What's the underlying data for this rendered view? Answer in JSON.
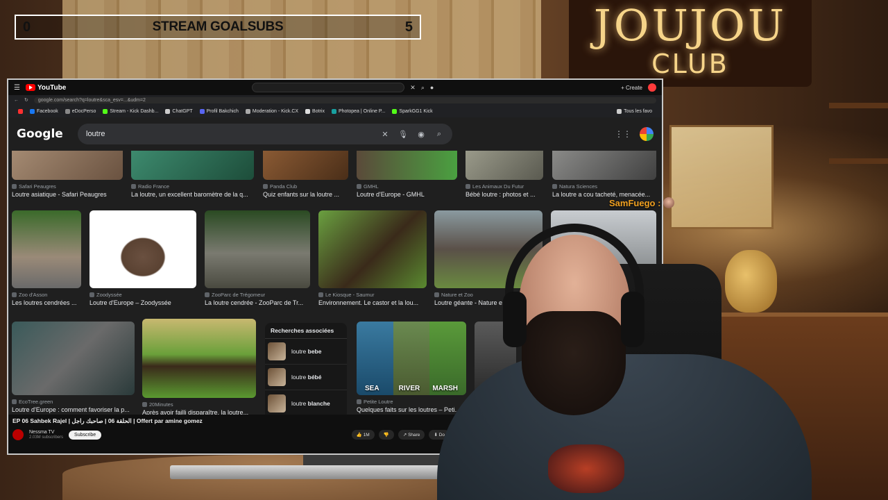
{
  "stream_goal": {
    "current": "0",
    "label": "STREAM GOALSUBS",
    "target": "5"
  },
  "brand": {
    "title": "JOUJOU",
    "subtitle": "CLUB"
  },
  "chat": {
    "username": "SamFuego :"
  },
  "youtube": {
    "logo_text": "YouTube",
    "create_label": "+ Create",
    "video_title": "EP 06 Sahbek Rajel | الحلقة 06 | صاحبك راجل | Offert par amine gomez",
    "channel_name": "Nessma TV",
    "channel_subs": "2.03M subscribers",
    "subscribe_label": "Subscribe",
    "actions": [
      "👍 1M",
      "👎",
      "↗ Share",
      "⬇ Do"
    ]
  },
  "browser": {
    "url": "google.com/search?q=loutre&sca_esv=...&udm=2",
    "bookmarks": [
      "Facebook",
      "eDocPerso",
      "Stream - Kick Dashb...",
      "ChatGPT",
      "Profil Bakchich",
      "Moderation - Kick.CX",
      "Botrix",
      "Photopea | Online P...",
      "SparkGG1 Kick"
    ],
    "bookmarks_right": "Tous les favo"
  },
  "google": {
    "logo": "Google",
    "query": "loutre",
    "icons": {
      "clear": "close-icon",
      "mic": "microphone-icon",
      "lens": "camera-icon",
      "search": "search-icon",
      "apps": "apps-grid-icon"
    }
  },
  "results_row1": [
    {
      "source": "Safari Peaugres",
      "caption": "Loutre asiatique - Safari Peaugres"
    },
    {
      "source": "Radio France",
      "caption": "La loutre, un excellent baromètre de la q..."
    },
    {
      "source": "Panda Club",
      "caption": "Quiz enfants sur la loutre ..."
    },
    {
      "source": "GMHL",
      "caption": "Loutre d'Europe - GMHL"
    },
    {
      "source": "Les Animaux Du Futur",
      "caption": "Bébé loutre : photos et ..."
    },
    {
      "source": "Natura Sciences",
      "caption": "La loutre a cou tacheté, menacée..."
    }
  ],
  "results_row2": [
    {
      "source": "Zoo d'Asson",
      "caption": "Les loutres cendrées ..."
    },
    {
      "source": "Zoodyssée",
      "caption": "Loutre d'Europe – Zoodyssée"
    },
    {
      "source": "ZooParc de Trégomeur",
      "caption": "La loutre cendrée - ZooParc de Tr..."
    },
    {
      "source": "Le Kiosque - Saumur",
      "caption": "Environnement. Le castor et la lou..."
    },
    {
      "source": "Nature et Zoo",
      "caption": "Loutre géante - Nature e..."
    }
  ],
  "results_row3": [
    {
      "source": "EcoTree.green",
      "caption": "Loutre d'Europe : comment favoriser la p..."
    },
    {
      "source": "20Minutes",
      "caption": "Après avoir failli disparaître, la loutre..."
    },
    {
      "source": "Petite Loutre",
      "caption": "Quelques faits sur les loutres – Peti..."
    }
  ],
  "sea_labels": [
    "SEA",
    "RIVER",
    "MARSH"
  ],
  "related": {
    "title": "Recherches associées",
    "items": [
      {
        "prefix": "loutre ",
        "bold": "bebe"
      },
      {
        "prefix": "loutre ",
        "bold": "bébé"
      },
      {
        "prefix": "loutre ",
        "bold": "blanche"
      }
    ]
  },
  "colors": {
    "accent_goal": "#ffffff",
    "chat_user": "#f0a020",
    "google_bg": "#1f1f1f",
    "brand_glow": "#f6d489"
  }
}
